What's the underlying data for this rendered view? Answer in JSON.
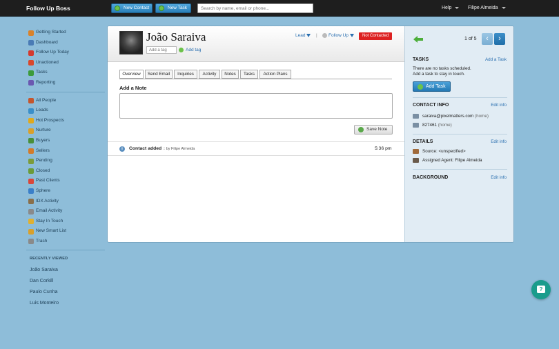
{
  "topbar": {
    "brand": "Follow Up Boss",
    "new_contact": "New Contact",
    "new_task": "New Task",
    "search_placeholder": "Search by name, email or phone...",
    "help": "Help",
    "user": "Filipe Almeida"
  },
  "sidebar": {
    "group1": [
      {
        "label": "Getting Started",
        "icon": "rocket-icon",
        "color": "#d9822b"
      },
      {
        "label": "Dashboard",
        "icon": "dashboard-icon",
        "color": "#4a7bb5"
      },
      {
        "label": "Follow Up Today",
        "icon": "target-icon",
        "color": "#d43a2f"
      },
      {
        "label": "Unactioned",
        "icon": "pin-icon",
        "color": "#d9472b"
      },
      {
        "label": "Tasks",
        "icon": "check-icon",
        "color": "#3c9b3a"
      },
      {
        "label": "Reporting",
        "icon": "chart-icon",
        "color": "#6b58b0"
      }
    ],
    "group2": [
      {
        "label": "All People",
        "icon": "people-icon",
        "color": "#c4562d"
      },
      {
        "label": "Leads",
        "icon": "lead-icon",
        "color": "#3a8fc9"
      },
      {
        "label": "Hot Prospects",
        "icon": "star-icon",
        "color": "#e0a81c"
      },
      {
        "label": "Nurture",
        "icon": "nurture-icon",
        "color": "#d9a02b"
      },
      {
        "label": "Buyers",
        "icon": "car-icon",
        "color": "#4a8f3a"
      },
      {
        "label": "Sellers",
        "icon": "house-icon",
        "color": "#d27b2b"
      },
      {
        "label": "Pending",
        "icon": "pending-icon",
        "color": "#7c9b3a"
      },
      {
        "label": "Closed",
        "icon": "closed-icon",
        "color": "#6b9b3a"
      },
      {
        "label": "Past Clients",
        "icon": "heart-icon",
        "color": "#d9473a"
      },
      {
        "label": "Sphere",
        "icon": "sphere-icon",
        "color": "#3a7fc9"
      },
      {
        "label": "IDX Activity",
        "icon": "idx-icon",
        "color": "#8a6f4a"
      },
      {
        "label": "Email Activity",
        "icon": "email-icon",
        "color": "#8a8a8a"
      },
      {
        "label": "Stay In Touch",
        "icon": "chat-icon",
        "color": "#e0b030"
      },
      {
        "label": "New Smart List",
        "icon": "smart-list-icon",
        "color": "#d9a02b"
      },
      {
        "label": "Trash",
        "icon": "trash-icon",
        "color": "#8a8a8a"
      }
    ],
    "recent_title": "RECENTLY VIEWED",
    "recent": [
      "João Saraiva",
      "Dan Corkill",
      "Paulo Cunha",
      "Luis Monteiro"
    ]
  },
  "contact": {
    "name": "João Saraiva",
    "tag_placeholder": "Add a tag",
    "add_tag": "Add tag",
    "stage": "Lead",
    "separator": "|",
    "follow": "Follow Up",
    "status": "Not Contacted"
  },
  "tabs": [
    "Overview",
    "Send Email",
    "Inquiries",
    "Activity",
    "Notes",
    "Tasks",
    "Action Plans"
  ],
  "note": {
    "title": "Add a Note",
    "save": "Save Note"
  },
  "activity": {
    "title": "Contact added",
    "by": ":: by Filipe Almeida",
    "time": "5:36 pm"
  },
  "pager": {
    "count": "1 of 5",
    "prev": "‹",
    "next": "›"
  },
  "right": {
    "tasks_title": "TASKS",
    "add_task_link": "Add a Task",
    "no_tasks": "There are no tasks scheduled.",
    "no_tasks_hint": "Add a task to stay in touch.",
    "add_task_button": "Add Task",
    "contact_title": "CONTACT INFO",
    "contact_edit": "Edit info",
    "email": "saraiva@pixelmatters.com",
    "email_type": "(home)",
    "phone": "827461",
    "phone_type": "(home)",
    "details_title": "DETAILS",
    "details_edit": "Edit info",
    "source": "Source: <unspecified>",
    "agent": "Assigned Agent: Filipe Almeida",
    "background_title": "BACKGROUND",
    "background_edit": "Edit info"
  },
  "chat_widget": "?"
}
